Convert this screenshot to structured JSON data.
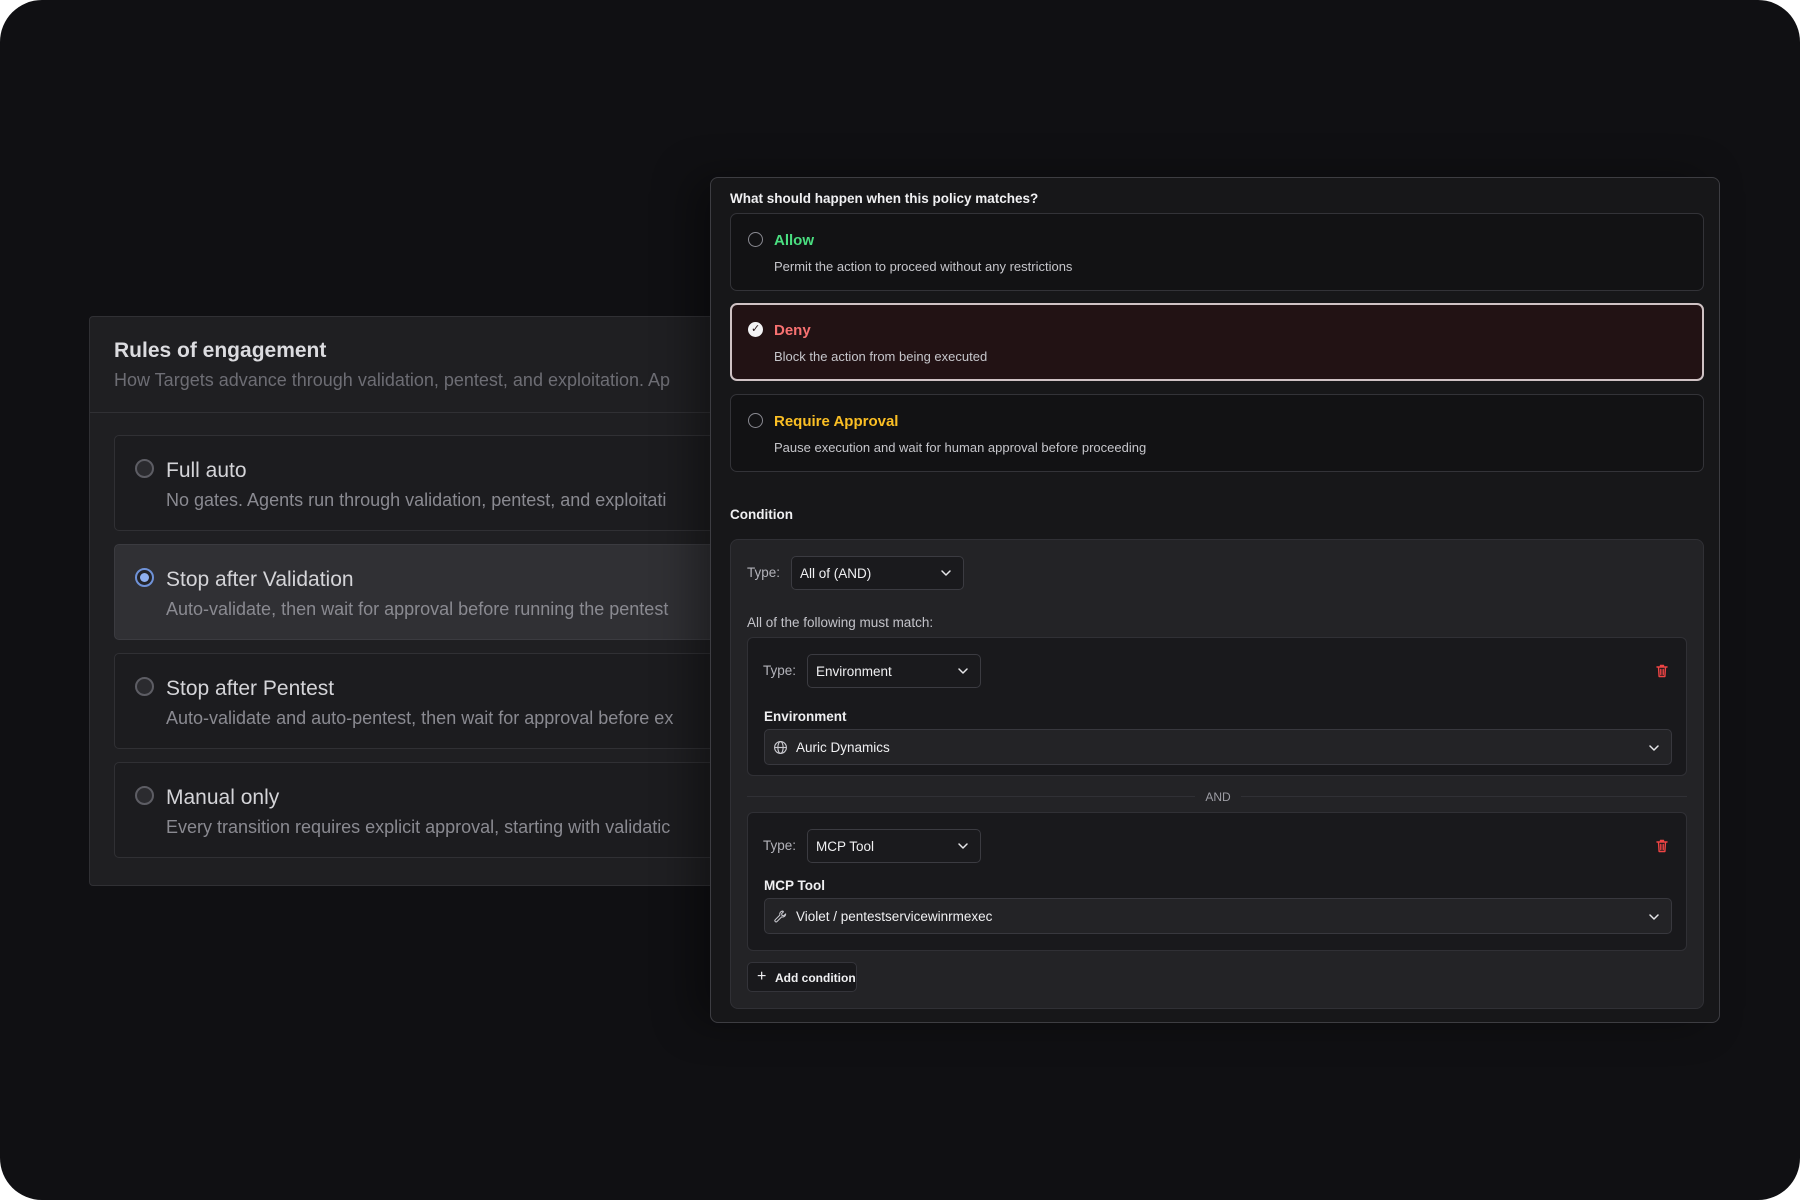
{
  "rules_panel": {
    "title": "Rules of engagement",
    "subtitle": "How Targets advance through validation, pentest, and exploitation. Ap",
    "options": [
      {
        "label": "Full auto",
        "description": "No gates. Agents run through validation, pentest, and exploitati",
        "selected": false
      },
      {
        "label": "Stop after Validation",
        "description": "Auto-validate, then wait for approval before running the pentest",
        "selected": true
      },
      {
        "label": "Stop after Pentest",
        "description": "Auto-validate and auto-pentest, then wait for approval before ex",
        "selected": false
      },
      {
        "label": "Manual only",
        "description": "Every transition requires explicit approval, starting with validatic",
        "selected": false
      }
    ]
  },
  "policy": {
    "question": "What should happen when this policy matches?",
    "actions": [
      {
        "label": "Allow",
        "description": "Permit the action to proceed without any restrictions",
        "selected": false,
        "color": "#4ade80"
      },
      {
        "label": "Deny",
        "description": "Block the action from being executed",
        "selected": true,
        "color": "#f87171"
      },
      {
        "label": "Require Approval",
        "description": "Pause execution and wait for human approval before proceeding",
        "selected": false,
        "color": "#fbbf24"
      }
    ],
    "condition": {
      "label": "Condition",
      "type_label": "Type:",
      "type_value": "All of (AND)",
      "match_text": "All of the following must match:",
      "items": [
        {
          "type_label": "Type:",
          "type_value": "Environment",
          "field_label": "Environment",
          "field_value": "Auric Dynamics",
          "field_icon": "globe-icon"
        },
        {
          "type_label": "Type:",
          "type_value": "MCP Tool",
          "field_label": "MCP Tool",
          "field_value": "Violet / pentestservicewinrmexec",
          "field_icon": "wrench-icon"
        }
      ],
      "separator": "AND",
      "add_button": "Add condition"
    }
  },
  "colors": {
    "allow": "#4ade80",
    "deny": "#f87171",
    "require_approval": "#fbbf24",
    "trash": "#ef4444",
    "radio_selected": "#8fb0f0"
  }
}
